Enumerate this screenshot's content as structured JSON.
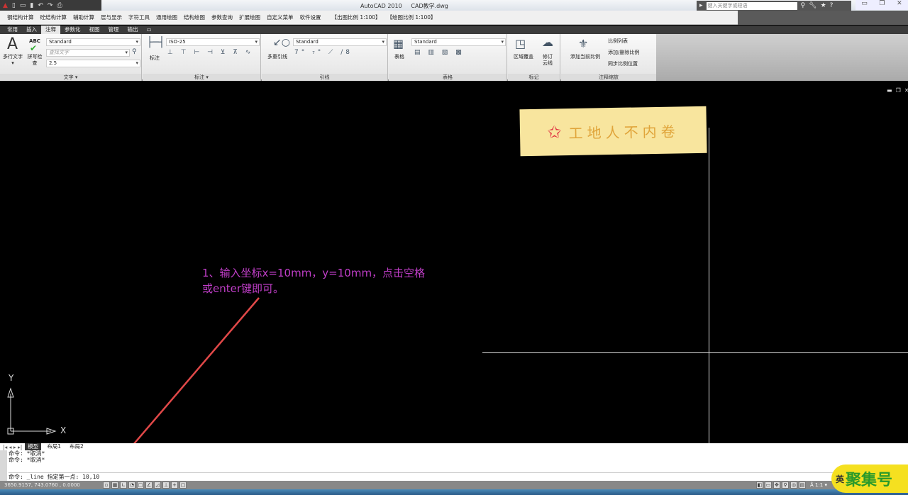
{
  "title_bar": {
    "app": "AutoCAD 2010",
    "file": "CAD教学.dwg",
    "search_placeholder": "键入关键字或短语"
  },
  "menu": [
    "钢结构计算",
    "砼结构计算",
    "辅助计算",
    "层与显示",
    "字符工具",
    "通用绘图",
    "结构绘图",
    "参数查询",
    "扩展绘图",
    "自定义菜单",
    "软件设置",
    "【出图比例 1:100】",
    "【绘图比例 1:100】"
  ],
  "tabs": [
    "常用",
    "插入",
    "注释",
    "参数化",
    "视图",
    "管理",
    "输出"
  ],
  "active_tab": "注释",
  "ribbon": {
    "text_panel": {
      "title": "文字 ▾",
      "multiline": "多行文字▾",
      "spell": "拼写检查",
      "abc": "ABC",
      "style": "Standard",
      "find_placeholder": "查找文字",
      "height": "2.5"
    },
    "dim_panel": {
      "title": "标注 ▾",
      "dim": "标注",
      "style": "ISO-25"
    },
    "leader_panel": {
      "title": "引线",
      "multileader": "多重引线",
      "style": "Standard"
    },
    "table_panel": {
      "title": "表格",
      "table": "表格",
      "style": "Standard"
    },
    "markup_panel": {
      "title": "标记",
      "wipeout": "区域覆盖",
      "revcloud": "修订云线"
    },
    "scale_panel": {
      "title": "注释缩放",
      "add_current": "添加当前比例",
      "scale_list": "比例列表",
      "add_delete": "添加/删除比例",
      "sync": "同步比例位置"
    }
  },
  "canvas": {
    "note": "工地人不内卷",
    "annotation_line1": "1、输入坐标x=10mm，y=10mm，点击空格",
    "annotation_line2": "或enter键即可。",
    "ucs_x": "X",
    "ucs_y": "Y",
    "annotation_color": "#c03ec8"
  },
  "layout_tabs": [
    "模型",
    "布局1",
    "布局2"
  ],
  "command": {
    "lines": [
      "命令: *取消*",
      "命令: *取消*"
    ],
    "current": "命令: _line 指定第一点: 10,10"
  },
  "status": {
    "coords": "3650.9157, 743.0760 , 0.0000",
    "scale": "1:1"
  },
  "watermark": "英聚集号"
}
